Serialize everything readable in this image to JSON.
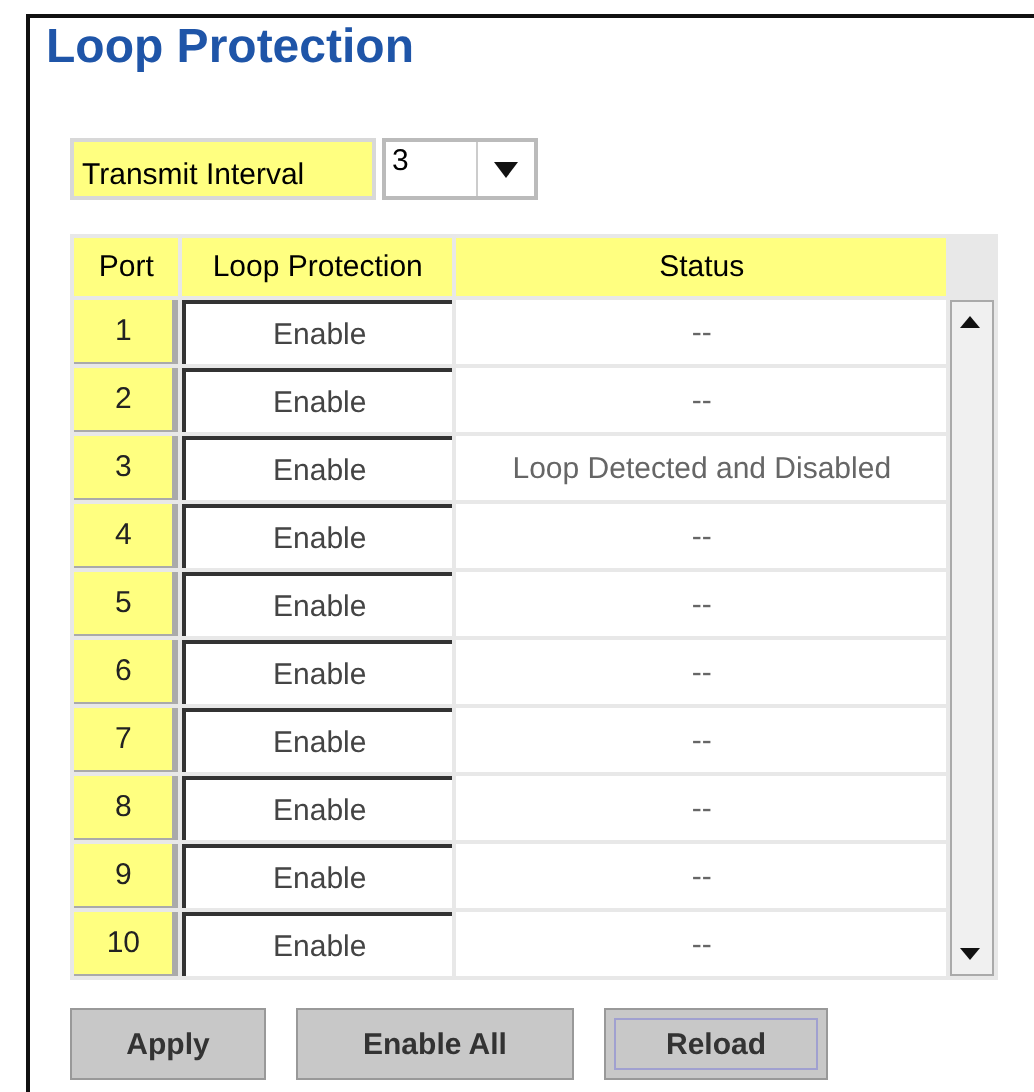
{
  "title": "Loop Protection",
  "transmit_interval": {
    "label": "Transmit Interval",
    "value": "3"
  },
  "table": {
    "columns": [
      "Port",
      "Loop Protection",
      "Status"
    ],
    "rows": [
      {
        "port": "1",
        "loop_protection": "Enable",
        "status": "--"
      },
      {
        "port": "2",
        "loop_protection": "Enable",
        "status": "--"
      },
      {
        "port": "3",
        "loop_protection": "Enable",
        "status": "Loop Detected and Disabled"
      },
      {
        "port": "4",
        "loop_protection": "Enable",
        "status": "--"
      },
      {
        "port": "5",
        "loop_protection": "Enable",
        "status": "--"
      },
      {
        "port": "6",
        "loop_protection": "Enable",
        "status": "--"
      },
      {
        "port": "7",
        "loop_protection": "Enable",
        "status": "--"
      },
      {
        "port": "8",
        "loop_protection": "Enable",
        "status": "--"
      },
      {
        "port": "9",
        "loop_protection": "Enable",
        "status": "--"
      },
      {
        "port": "10",
        "loop_protection": "Enable",
        "status": "--"
      }
    ]
  },
  "buttons": [
    {
      "label": "Apply",
      "focused": false
    },
    {
      "label": "Enable All",
      "focused": false
    },
    {
      "label": "Reload",
      "focused": true
    }
  ]
}
